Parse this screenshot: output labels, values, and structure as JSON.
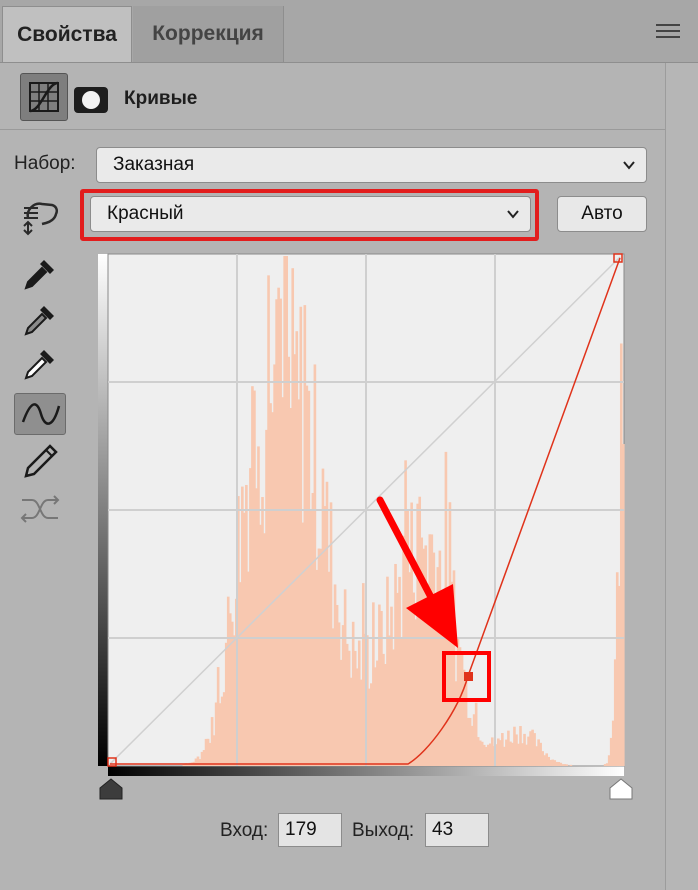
{
  "tabs": [
    {
      "label": "Свойства",
      "active": true
    },
    {
      "label": "Коррекция",
      "active": false
    }
  ],
  "header": {
    "title": "Кривые",
    "curves_icon": "curves-adjustment-icon",
    "mask_icon": "layer-mask-icon"
  },
  "preset": {
    "label": "Набор:",
    "value": "Заказная"
  },
  "channel": {
    "value": "Красный",
    "auto_label": "Авто"
  },
  "tools": [
    {
      "name": "on-image-adjust-icon",
      "selected": false
    },
    {
      "name": "black-point-eyedropper-icon",
      "selected": false
    },
    {
      "name": "gray-point-eyedropper-icon",
      "selected": false
    },
    {
      "name": "white-point-eyedropper-icon",
      "selected": false
    },
    {
      "name": "curve-points-icon",
      "selected": true
    },
    {
      "name": "pencil-icon",
      "selected": false
    },
    {
      "name": "smooth-curve-icon",
      "selected": false
    }
  ],
  "io": {
    "input_label": "Вход:",
    "input_value": "179",
    "output_label": "Выход:",
    "output_value": "43"
  },
  "colors": {
    "curve": "#e0331b",
    "histogram": "#f8c8b0",
    "highlight": "#ff0000"
  }
}
